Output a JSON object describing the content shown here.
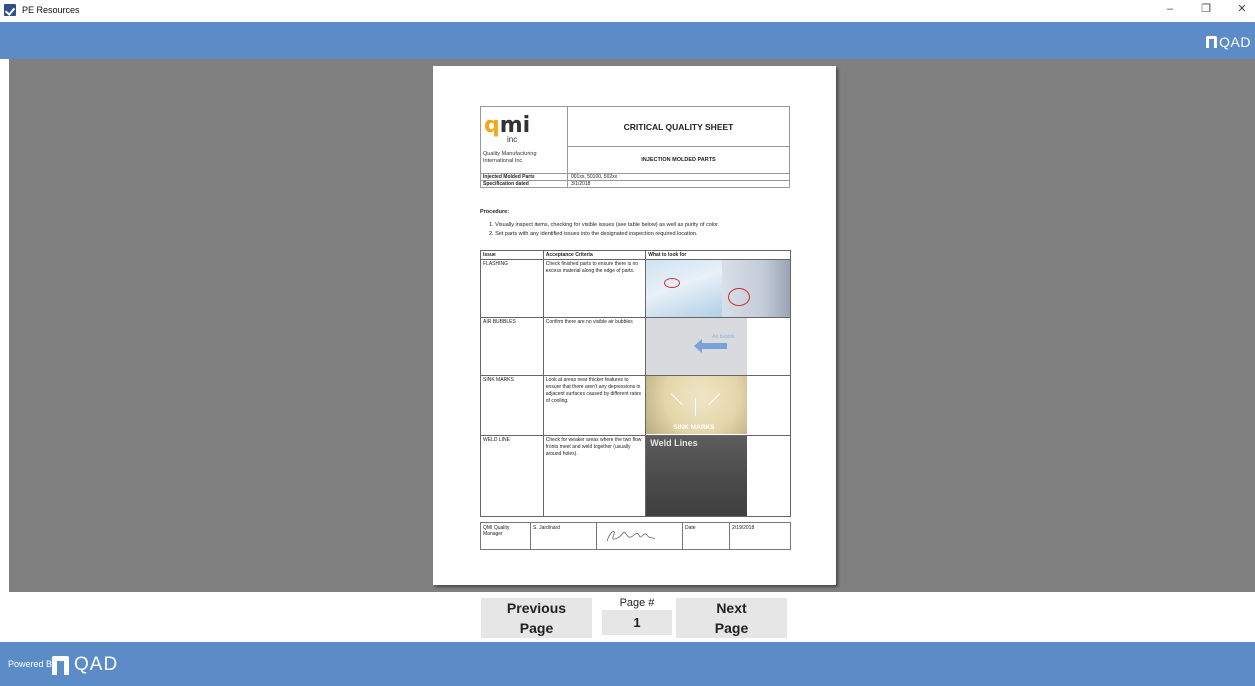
{
  "window": {
    "title": "PE Resources",
    "controls": {
      "minimize": "–",
      "restore": "❐",
      "close": "✕"
    }
  },
  "brand": {
    "logo_text": "QAD",
    "accent_color": "#5b8cc8"
  },
  "document": {
    "company_logo": {
      "letters_q": "q",
      "letters_mi": "mi",
      "suffix": "inc"
    },
    "company_name": "Quality Manufacturing International Inc.",
    "title": "CRITICAL QUALITY SHEET",
    "subtitle": "INJECTION MOLDED PARTS",
    "meta": [
      {
        "key": "Injected Molded Parts",
        "value": "001xx, 50100, 502xx"
      },
      {
        "key": "Specification dated",
        "value": "3/1/2018"
      }
    ],
    "procedure_title": "Procedure:",
    "procedure_steps": [
      "1.  Visually inspect items, checking for visible issues (see table below) as well as purity of color.",
      "2.  Set parts with any identified issues into the designated inspection required location."
    ],
    "table_headers": [
      "Issue",
      "Acceptance Criteria",
      "What to look for"
    ],
    "issues": [
      {
        "issue": "FLASHING",
        "criteria": "Check finished parts to ensure there is no excess material along the edge of parts."
      },
      {
        "issue": "AIR BUBBLES",
        "criteria": "Confirm there are no visible air bubbles",
        "image_label": "Air bubble"
      },
      {
        "issue": "SINK MARKS",
        "criteria": "Look at areas near thicker features to ensure that there aren't any depressions in adjacent surfaces caused by different rates of cooling.",
        "image_label": "SINK MARKS"
      },
      {
        "issue": "WELD LINE",
        "criteria": "Check for weaker areas where the two flow fronts meet and weld together (usually around holes).",
        "image_label": "Weld Lines"
      }
    ],
    "signoff": {
      "role": "QMI Quality Manager",
      "name": "S. Jardinard",
      "date_label": "Date",
      "date": "2/19/2018"
    }
  },
  "navigation": {
    "previous_label_line1": "Previous",
    "previous_label_line2": "Page",
    "next_label_line1": "Next",
    "next_label_line2": "Page",
    "page_label": "Page #",
    "page_number": "1"
  },
  "footer": {
    "powered_by": "Powered By",
    "logo_text": "QAD"
  }
}
